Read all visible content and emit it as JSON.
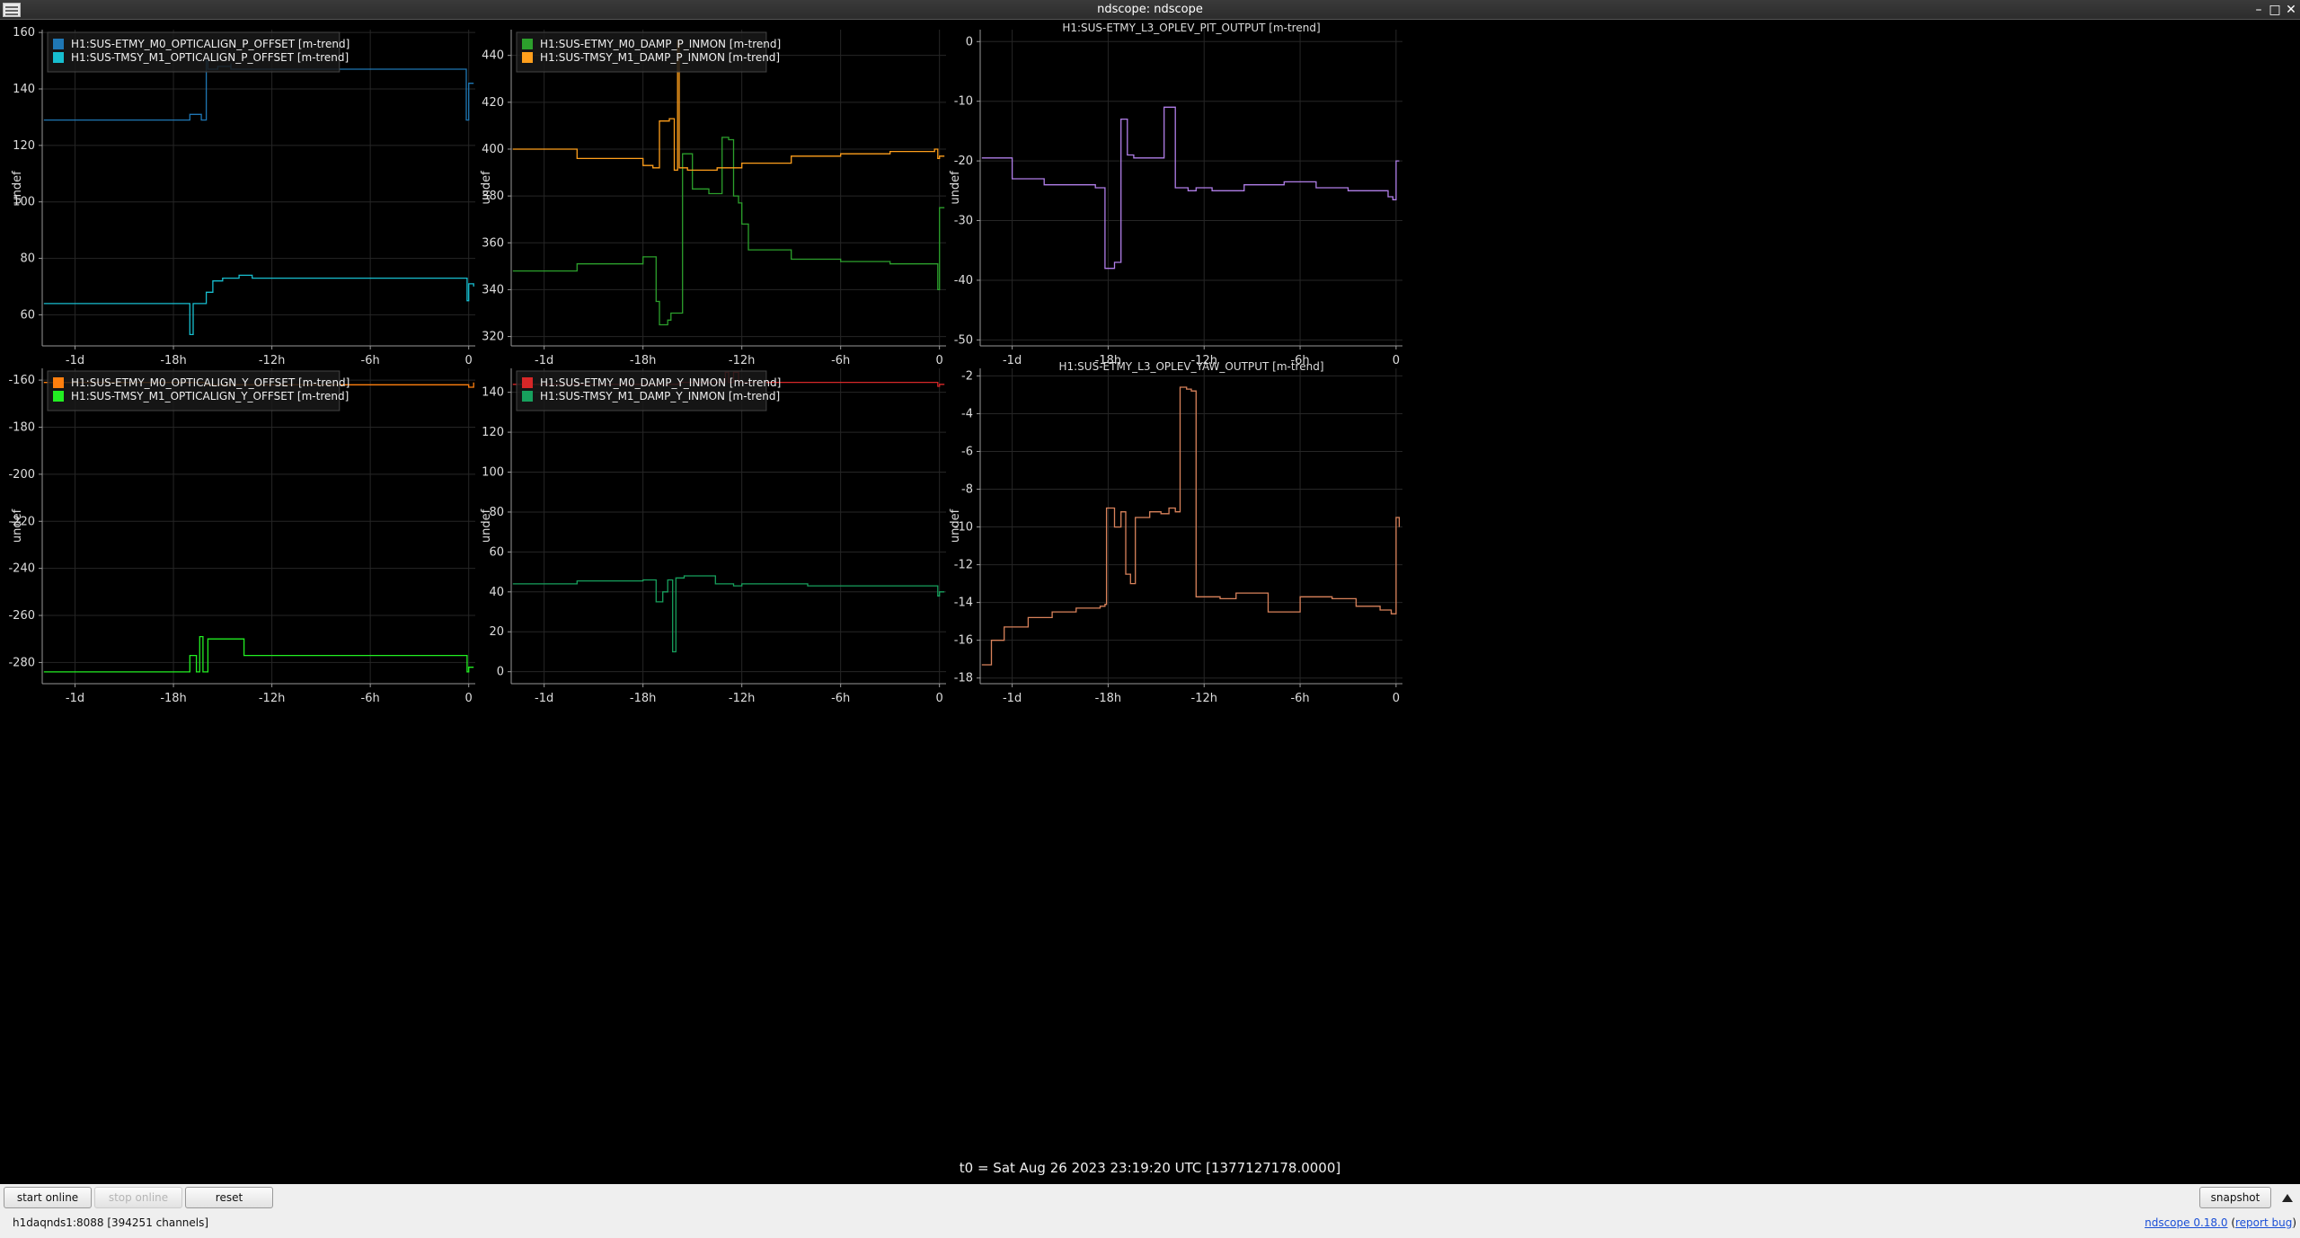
{
  "window": {
    "title": "ndscope: ndscope",
    "min": "–",
    "max": "□",
    "close": "✕"
  },
  "t0_label": "t0 = Sat Aug 26 2023 23:19:20 UTC [1377127178.0000]",
  "toolbar": {
    "start_online": "start online",
    "stop_online": "stop online",
    "reset": "reset",
    "snapshot": "snapshot"
  },
  "status": "h1daqnds1:8088  [394251 channels]",
  "version": {
    "text": "ndscope 0.18.0",
    "report": "report bug"
  },
  "colors": {
    "background": "#000000",
    "grid": "#2a2a2a",
    "axis": "#aaaaaa"
  },
  "plots": [
    {
      "id": "p_offset",
      "title": "",
      "ylabel": "undef",
      "yticks": [
        60,
        80,
        100,
        120,
        140,
        160
      ],
      "ylim": [
        49,
        161
      ],
      "xticks": [
        "-1d",
        "-18h",
        "-12h",
        "-6h",
        "0"
      ],
      "legend": [
        {
          "label": "H1:SUS-ETMY_M0_OPTICALIGN_P_OFFSET [m-trend]",
          "color": "#1f77b4"
        },
        {
          "label": "H1:SUS-TMSY_M1_OPTICALIGN_P_OFFSET [m-trend]",
          "color": "#17becf"
        }
      ]
    },
    {
      "id": "p_damp",
      "title": "",
      "ylabel": "undef",
      "yticks": [
        320,
        340,
        360,
        380,
        400,
        420,
        440
      ],
      "ylim": [
        316,
        451
      ],
      "xticks": [
        "-1d",
        "-18h",
        "-12h",
        "-6h",
        "0"
      ],
      "legend": [
        {
          "label": "H1:SUS-ETMY_M0_DAMP_P_INMON [m-trend]",
          "color": "#2ca02c"
        },
        {
          "label": "H1:SUS-TMSY_M1_DAMP_P_INMON [m-trend]",
          "color": "#ff9f1c"
        }
      ]
    },
    {
      "id": "pit",
      "title": "H1:SUS-ETMY_L3_OPLEV_PIT_OUTPUT [m-trend]",
      "ylabel": "undef",
      "yticks": [
        0,
        -10,
        -20,
        -30,
        -40,
        -50
      ],
      "ylim": [
        -51,
        2
      ],
      "xticks": [
        "-1d",
        "-18h",
        "-12h",
        "-6h",
        "0"
      ],
      "legend": []
    },
    {
      "id": "y_offset",
      "title": "",
      "ylabel": "undef",
      "yticks": [
        -160,
        -180,
        -200,
        -220,
        -240,
        -260,
        -280
      ],
      "ylim": [
        -289,
        -155
      ],
      "xticks": [
        "-1d",
        "-18h",
        "-12h",
        "-6h",
        "0"
      ],
      "legend": [
        {
          "label": "H1:SUS-ETMY_M0_OPTICALIGN_Y_OFFSET [m-trend]",
          "color": "#ff7f0e"
        },
        {
          "label": "H1:SUS-TMSY_M1_OPTICALIGN_Y_OFFSET [m-trend]",
          "color": "#22ee22"
        }
      ]
    },
    {
      "id": "y_damp",
      "title": "",
      "ylabel": "undef",
      "yticks": [
        0,
        20,
        40,
        60,
        80,
        100,
        120,
        140
      ],
      "ylim": [
        -6,
        152
      ],
      "xticks": [
        "-1d",
        "-18h",
        "-12h",
        "-6h",
        "0"
      ],
      "legend": [
        {
          "label": "H1:SUS-ETMY_M0_DAMP_Y_INMON [m-trend]",
          "color": "#d62728"
        },
        {
          "label": "H1:SUS-TMSY_M1_DAMP_Y_INMON [m-trend]",
          "color": "#17a05d"
        }
      ]
    },
    {
      "id": "yaw",
      "title": "H1:SUS-ETMY_L3_OPLEV_YAW_OUTPUT [m-trend]",
      "ylabel": "undef",
      "yticks": [
        -2,
        -4,
        -6,
        -8,
        -10,
        -12,
        -14,
        -16,
        -18
      ],
      "ylim": [
        -18.3,
        -1.6
      ],
      "xticks": [
        "-1d",
        "-18h",
        "-12h",
        "-6h",
        "0"
      ],
      "legend": []
    }
  ],
  "chart_data": [
    {
      "type": "line",
      "title": "",
      "xlabel": "",
      "ylabel": "undef",
      "x_unit": "hours relative to t0",
      "xlim": [
        -26,
        0.4
      ],
      "ylim": [
        49,
        161
      ],
      "series": [
        {
          "name": "H1:SUS-ETMY_M0_OPTICALIGN_P_OFFSET [m-trend]",
          "x": [
            -25.9,
            -17.2,
            -17.0,
            -16.3,
            -16.0,
            -15.9,
            -15.3,
            -14.5,
            -14.5,
            -0.2,
            -0.15,
            0,
            0.3
          ],
          "y": [
            129,
            129,
            131,
            129,
            150,
            147,
            148,
            149,
            147,
            147,
            129,
            142,
            142
          ]
        },
        {
          "name": "H1:SUS-TMSY_M1_OPTICALIGN_P_OFFSET [m-trend]",
          "x": [
            -25.9,
            -17.2,
            -17.0,
            -16.8,
            -16.5,
            -16.0,
            -15.6,
            -15.0,
            -14.0,
            -13.2,
            -13.2,
            -0.2,
            -0.1,
            0,
            0.3
          ],
          "y": [
            64,
            64,
            53,
            64,
            64,
            68,
            72,
            73,
            74,
            74,
            73,
            73,
            65,
            71,
            70
          ]
        }
      ]
    },
    {
      "type": "line",
      "title": "",
      "xlabel": "",
      "ylabel": "undef",
      "x_unit": "hours relative to t0",
      "xlim": [
        -26,
        0.4
      ],
      "ylim": [
        316,
        451
      ],
      "series": [
        {
          "name": "H1:SUS-ETMY_M0_DAMP_P_INMON [m-trend]",
          "x": [
            -25.9,
            -22,
            -18,
            -17.4,
            -17.2,
            -17.0,
            -16.5,
            -16.3,
            -15.6,
            -15.0,
            -14.0,
            -13.2,
            -12.8,
            -12.5,
            -12.2,
            -12.0,
            -11.6,
            -9.0,
            -6.0,
            -3.0,
            -0.2,
            -0.1,
            0,
            0.3
          ],
          "y": [
            348,
            351,
            354,
            354,
            335,
            325,
            327,
            330,
            398,
            383,
            381,
            405,
            404,
            380,
            377,
            368,
            357,
            353,
            352,
            351,
            351,
            340,
            375,
            375
          ]
        },
        {
          "name": "H1:SUS-TMSY_M1_DAMP_P_INMON [m-trend]",
          "x": [
            -25.9,
            -22,
            -18,
            -17.4,
            -17.2,
            -17.0,
            -16.4,
            -16.1,
            -15.9,
            -15.8,
            -15.3,
            -14.5,
            -13.5,
            -12.0,
            -9.0,
            -6.0,
            -3.0,
            -0.3,
            -0.1,
            0,
            0.3
          ],
          "y": [
            400,
            396,
            393,
            392,
            392,
            412,
            413,
            391,
            446,
            392,
            391,
            391,
            392,
            394,
            397,
            398,
            399,
            400,
            396,
            397,
            397
          ]
        }
      ]
    },
    {
      "type": "line",
      "title": "H1:SUS-ETMY_L3_OPLEV_PIT_OUTPUT [m-trend]",
      "xlabel": "",
      "ylabel": "undef",
      "x_unit": "hours relative to t0",
      "xlim": [
        -26,
        0.4
      ],
      "ylim": [
        -51,
        2
      ],
      "series": [
        {
          "name": "",
          "x": [
            -25.9,
            -24,
            -22,
            -18.8,
            -18.5,
            -18.2,
            -17.6,
            -17.2,
            -16.8,
            -16.4,
            -15.5,
            -14.5,
            -14.2,
            -13.8,
            -13.0,
            -12.5,
            -11.5,
            -9.5,
            -7.0,
            -5.0,
            -3.0,
            -0.5,
            -0.2,
            0,
            0.2
          ],
          "y": [
            -19.5,
            -23,
            -24,
            -24.5,
            -24.5,
            -38,
            -37,
            -13,
            -19,
            -19.5,
            -19.5,
            -11,
            -11,
            -24.5,
            -25,
            -24.5,
            -25,
            -24,
            -23.5,
            -24.5,
            -25,
            -26,
            -26.5,
            -20,
            -20
          ]
        }
      ]
    },
    {
      "type": "line",
      "title": "",
      "xlabel": "",
      "ylabel": "undef",
      "x_unit": "hours relative to t0",
      "xlim": [
        -26,
        0.4
      ],
      "ylim": [
        -289,
        -155
      ],
      "series": [
        {
          "name": "H1:SUS-ETMY_M0_OPTICALIGN_Y_OFFSET [m-trend]",
          "x": [
            -25.9,
            -16.5,
            -16.0,
            -15.5,
            -0.2,
            0,
            0.3
          ],
          "y": [
            -161,
            -161,
            -162,
            -162,
            -162,
            -163,
            -161
          ]
        },
        {
          "name": "H1:SUS-TMSY_M1_OPTICALIGN_Y_OFFSET [m-trend]",
          "x": [
            -25.9,
            -17.2,
            -17.0,
            -16.6,
            -16.4,
            -16.2,
            -15.9,
            -15.5,
            -14.0,
            -13.7,
            -13.5,
            -0.2,
            -0.1,
            0,
            0.3
          ],
          "y": [
            -284,
            -284,
            -277,
            -284,
            -269,
            -284,
            -270,
            -270,
            -270,
            -277,
            -277,
            -277,
            -284,
            -282,
            -282
          ]
        }
      ]
    },
    {
      "type": "line",
      "title": "",
      "xlabel": "",
      "ylabel": "undef",
      "x_unit": "hours relative to t0",
      "xlim": [
        -26,
        0.4
      ],
      "ylim": [
        -6,
        152
      ],
      "series": [
        {
          "name": "H1:SUS-ETMY_M0_DAMP_Y_INMON [m-trend]",
          "x": [
            -25.9,
            -16.0,
            -15.8,
            -13.6,
            -13.0,
            -12.8,
            -12.5,
            -12.2,
            -8,
            -4,
            -0.2,
            -0.1,
            0,
            0.3
          ],
          "y": [
            144,
            144,
            145,
            145,
            150,
            145,
            150,
            145,
            145,
            145,
            145,
            143,
            144,
            144
          ]
        },
        {
          "name": "H1:SUS-TMSY_M1_DAMP_Y_INMON [m-trend]",
          "x": [
            -25.9,
            -22,
            -18,
            -17.3,
            -17.2,
            -16.8,
            -16.5,
            -16.2,
            -16.0,
            -15.8,
            -15.5,
            -14.0,
            -13.6,
            -12.5,
            -12.0,
            -8,
            -4,
            -0.2,
            -0.1,
            0,
            0.3
          ],
          "y": [
            44,
            45.5,
            46,
            46,
            35,
            40,
            46,
            10,
            47,
            47,
            48,
            48,
            44,
            43,
            44,
            43,
            43,
            43,
            38,
            40,
            40
          ]
        }
      ]
    },
    {
      "type": "line",
      "title": "H1:SUS-ETMY_L3_OPLEV_YAW_OUTPUT [m-trend]",
      "xlabel": "",
      "ylabel": "undef",
      "x_unit": "hours relative to t0",
      "xlim": [
        -26,
        0.4
      ],
      "ylim": [
        -18.3,
        -1.6
      ],
      "series": [
        {
          "name": "",
          "x": [
            -25.9,
            -25.3,
            -24.5,
            -23.0,
            -21.5,
            -20.0,
            -18.5,
            -18.2,
            -18.1,
            -17.6,
            -17.2,
            -16.9,
            -16.6,
            -16.3,
            -15.8,
            -15.4,
            -15.0,
            -14.7,
            -14.2,
            -13.8,
            -13.5,
            -13.1,
            -12.8,
            -12.5,
            -11.0,
            -10.0,
            -8.0,
            -6.0,
            -4.0,
            -2.5,
            -1.0,
            -0.3,
            0,
            0.2
          ],
          "y": [
            -17.3,
            -16,
            -15.3,
            -14.8,
            -14.5,
            -14.3,
            -14.2,
            -14.1,
            -9,
            -10,
            -9.2,
            -12.5,
            -13,
            -9.5,
            -9.5,
            -9.2,
            -9.2,
            -9.3,
            -9.0,
            -9.2,
            -2.6,
            -2.7,
            -2.8,
            -13.7,
            -13.8,
            -13.5,
            -14.5,
            -13.7,
            -13.8,
            -14.2,
            -14.4,
            -14.6,
            -9.5,
            -10
          ]
        }
      ]
    }
  ]
}
